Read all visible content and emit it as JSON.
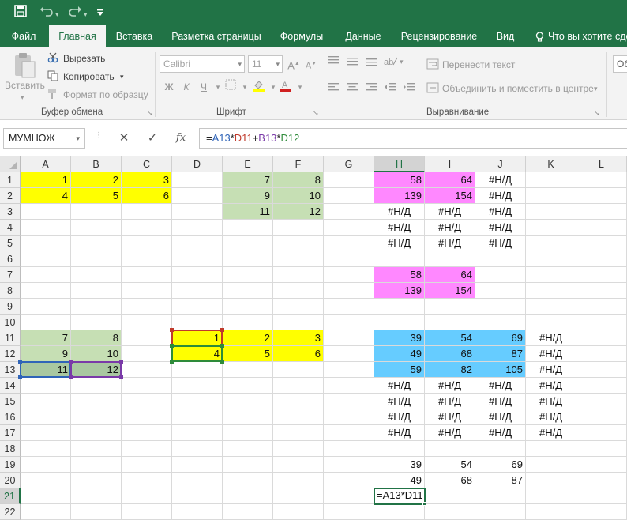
{
  "title_bar": {
    "save_icon": "save-icon",
    "undo_icon": "undo-icon",
    "redo_icon": "redo-icon",
    "customize_icon": "customize-toolbar-icon"
  },
  "tabs": [
    "Файл",
    "Главная",
    "Вставка",
    "Разметка страницы",
    "Формулы",
    "Данные",
    "Рецензирование",
    "Вид"
  ],
  "active_tab": "Главная",
  "tell_me": "Что вы хотите сделать?",
  "clipboard": {
    "paste": "Вставить",
    "cut": "Вырезать",
    "copy": "Копировать",
    "format_painter": "Формат по образцу",
    "group_label": "Буфер обмена"
  },
  "font": {
    "name": "Calibri",
    "size": "11",
    "group_label": "Шрифт",
    "bold": "Ж",
    "italic": "К",
    "underline": "Ч"
  },
  "alignment": {
    "wrap_text": "Перенести текст",
    "merge_center": "Объединить и поместить в центре",
    "group_label": "Выравнивание"
  },
  "number_group_partial": "Об",
  "formula_bar": {
    "name_box": "МУМНОЖ",
    "cancel": "✕",
    "enter": "✓",
    "fx": "fx",
    "formula_parts": [
      {
        "text": "=",
        "color": "#222222"
      },
      {
        "text": "A13",
        "color": "#2f64b8"
      },
      {
        "text": "*",
        "color": "#222222"
      },
      {
        "text": "D11",
        "color": "#c0392b"
      },
      {
        "text": "+",
        "color": "#222222"
      },
      {
        "text": "B13",
        "color": "#7a3aa8"
      },
      {
        "text": "*",
        "color": "#222222"
      },
      {
        "text": "D12",
        "color": "#2e8b3a"
      }
    ]
  },
  "columns": [
    "A",
    "B",
    "C",
    "D",
    "E",
    "F",
    "G",
    "H",
    "I",
    "J",
    "K",
    "L"
  ],
  "selected_column": "H",
  "rows": [
    "1",
    "2",
    "3",
    "4",
    "5",
    "6",
    "7",
    "8",
    "9",
    "10",
    "11",
    "12",
    "13",
    "14",
    "15",
    "16",
    "17",
    "18",
    "19",
    "20",
    "21",
    "22"
  ],
  "selected_row": "21",
  "colors": {
    "excel_green": "#217346",
    "yellow": "#ffff00",
    "green_fill": "#c6dfb4",
    "pink_fill": "#ff88ff",
    "blue_fill": "#66ccff"
  },
  "cells": [
    {
      "ref": "A1",
      "v": "1",
      "fill": "yel",
      "t": "num"
    },
    {
      "ref": "B1",
      "v": "2",
      "fill": "yel",
      "t": "num"
    },
    {
      "ref": "C1",
      "v": "3",
      "fill": "yel",
      "t": "num"
    },
    {
      "ref": "A2",
      "v": "4",
      "fill": "yel",
      "t": "num"
    },
    {
      "ref": "B2",
      "v": "5",
      "fill": "yel",
      "t": "num"
    },
    {
      "ref": "C2",
      "v": "6",
      "fill": "yel",
      "t": "num"
    },
    {
      "ref": "E1",
      "v": "7",
      "fill": "grn",
      "t": "num"
    },
    {
      "ref": "F1",
      "v": "8",
      "fill": "grn",
      "t": "num"
    },
    {
      "ref": "E2",
      "v": "9",
      "fill": "grn",
      "t": "num"
    },
    {
      "ref": "F2",
      "v": "10",
      "fill": "grn",
      "t": "num"
    },
    {
      "ref": "E3",
      "v": "11",
      "fill": "grn",
      "t": "num"
    },
    {
      "ref": "F3",
      "v": "12",
      "fill": "grn",
      "t": "num"
    },
    {
      "ref": "H1",
      "v": "58",
      "fill": "pnk",
      "t": "num"
    },
    {
      "ref": "I1",
      "v": "64",
      "fill": "pnk",
      "t": "num"
    },
    {
      "ref": "J1",
      "v": "#Н/Д",
      "t": "err"
    },
    {
      "ref": "H2",
      "v": "139",
      "fill": "pnk",
      "t": "num"
    },
    {
      "ref": "I2",
      "v": "154",
      "fill": "pnk",
      "t": "num"
    },
    {
      "ref": "J2",
      "v": "#Н/Д",
      "t": "err"
    },
    {
      "ref": "H3",
      "v": "#Н/Д",
      "t": "err"
    },
    {
      "ref": "I3",
      "v": "#Н/Д",
      "t": "err"
    },
    {
      "ref": "J3",
      "v": "#Н/Д",
      "t": "err"
    },
    {
      "ref": "H4",
      "v": "#Н/Д",
      "t": "err"
    },
    {
      "ref": "I4",
      "v": "#Н/Д",
      "t": "err"
    },
    {
      "ref": "J4",
      "v": "#Н/Д",
      "t": "err"
    },
    {
      "ref": "H5",
      "v": "#Н/Д",
      "t": "err"
    },
    {
      "ref": "I5",
      "v": "#Н/Д",
      "t": "err"
    },
    {
      "ref": "J5",
      "v": "#Н/Д",
      "t": "err"
    },
    {
      "ref": "H7",
      "v": "58",
      "fill": "pnk",
      "t": "num"
    },
    {
      "ref": "I7",
      "v": "64",
      "fill": "pnk",
      "t": "num"
    },
    {
      "ref": "H8",
      "v": "139",
      "fill": "pnk",
      "t": "num"
    },
    {
      "ref": "I8",
      "v": "154",
      "fill": "pnk",
      "t": "num"
    },
    {
      "ref": "A11",
      "v": "7",
      "fill": "grn",
      "t": "num"
    },
    {
      "ref": "B11",
      "v": "8",
      "fill": "grn",
      "t": "num"
    },
    {
      "ref": "A12",
      "v": "9",
      "fill": "grn",
      "t": "num"
    },
    {
      "ref": "B12",
      "v": "10",
      "fill": "grn",
      "t": "num"
    },
    {
      "ref": "A13",
      "v": "11",
      "fill": "gsel",
      "t": "num"
    },
    {
      "ref": "B13",
      "v": "12",
      "fill": "gsel",
      "t": "num"
    },
    {
      "ref": "D11",
      "v": "1",
      "fill": "yel",
      "t": "num"
    },
    {
      "ref": "D12",
      "v": "4",
      "fill": "yel",
      "t": "num"
    },
    {
      "ref": "E11",
      "v": "2",
      "fill": "yel",
      "t": "num"
    },
    {
      "ref": "F11",
      "v": "3",
      "fill": "yel",
      "t": "num"
    },
    {
      "ref": "E12",
      "v": "5",
      "fill": "yel",
      "t": "num"
    },
    {
      "ref": "F12",
      "v": "6",
      "fill": "yel",
      "t": "num"
    },
    {
      "ref": "H11",
      "v": "39",
      "fill": "blu",
      "t": "num"
    },
    {
      "ref": "I11",
      "v": "54",
      "fill": "blu",
      "t": "num"
    },
    {
      "ref": "J11",
      "v": "69",
      "fill": "blu",
      "t": "num"
    },
    {
      "ref": "K11",
      "v": "#Н/Д",
      "t": "err"
    },
    {
      "ref": "H12",
      "v": "49",
      "fill": "blu",
      "t": "num"
    },
    {
      "ref": "I12",
      "v": "68",
      "fill": "blu",
      "t": "num"
    },
    {
      "ref": "J12",
      "v": "87",
      "fill": "blu",
      "t": "num"
    },
    {
      "ref": "K12",
      "v": "#Н/Д",
      "t": "err"
    },
    {
      "ref": "H13",
      "v": "59",
      "fill": "blu",
      "t": "num"
    },
    {
      "ref": "I13",
      "v": "82",
      "fill": "blu",
      "t": "num"
    },
    {
      "ref": "J13",
      "v": "105",
      "fill": "blu",
      "t": "num"
    },
    {
      "ref": "K13",
      "v": "#Н/Д",
      "t": "err"
    },
    {
      "ref": "H14",
      "v": "#Н/Д",
      "t": "err"
    },
    {
      "ref": "I14",
      "v": "#Н/Д",
      "t": "err"
    },
    {
      "ref": "J14",
      "v": "#Н/Д",
      "t": "err"
    },
    {
      "ref": "K14",
      "v": "#Н/Д",
      "t": "err"
    },
    {
      "ref": "H15",
      "v": "#Н/Д",
      "t": "err"
    },
    {
      "ref": "I15",
      "v": "#Н/Д",
      "t": "err"
    },
    {
      "ref": "J15",
      "v": "#Н/Д",
      "t": "err"
    },
    {
      "ref": "K15",
      "v": "#Н/Д",
      "t": "err"
    },
    {
      "ref": "H16",
      "v": "#Н/Д",
      "t": "err"
    },
    {
      "ref": "I16",
      "v": "#Н/Д",
      "t": "err"
    },
    {
      "ref": "J16",
      "v": "#Н/Д",
      "t": "err"
    },
    {
      "ref": "K16",
      "v": "#Н/Д",
      "t": "err"
    },
    {
      "ref": "H17",
      "v": "#Н/Д",
      "t": "err"
    },
    {
      "ref": "I17",
      "v": "#Н/Д",
      "t": "err"
    },
    {
      "ref": "J17",
      "v": "#Н/Д",
      "t": "err"
    },
    {
      "ref": "K17",
      "v": "#Н/Д",
      "t": "err"
    },
    {
      "ref": "H19",
      "v": "39",
      "t": "num"
    },
    {
      "ref": "I19",
      "v": "54",
      "t": "num"
    },
    {
      "ref": "J19",
      "v": "69",
      "t": "num"
    },
    {
      "ref": "H20",
      "v": "49",
      "t": "num"
    },
    {
      "ref": "I20",
      "v": "68",
      "t": "num"
    },
    {
      "ref": "J20",
      "v": "87",
      "t": "num"
    }
  ],
  "active_cell": {
    "ref": "H21",
    "text": "=A13*D11"
  }
}
